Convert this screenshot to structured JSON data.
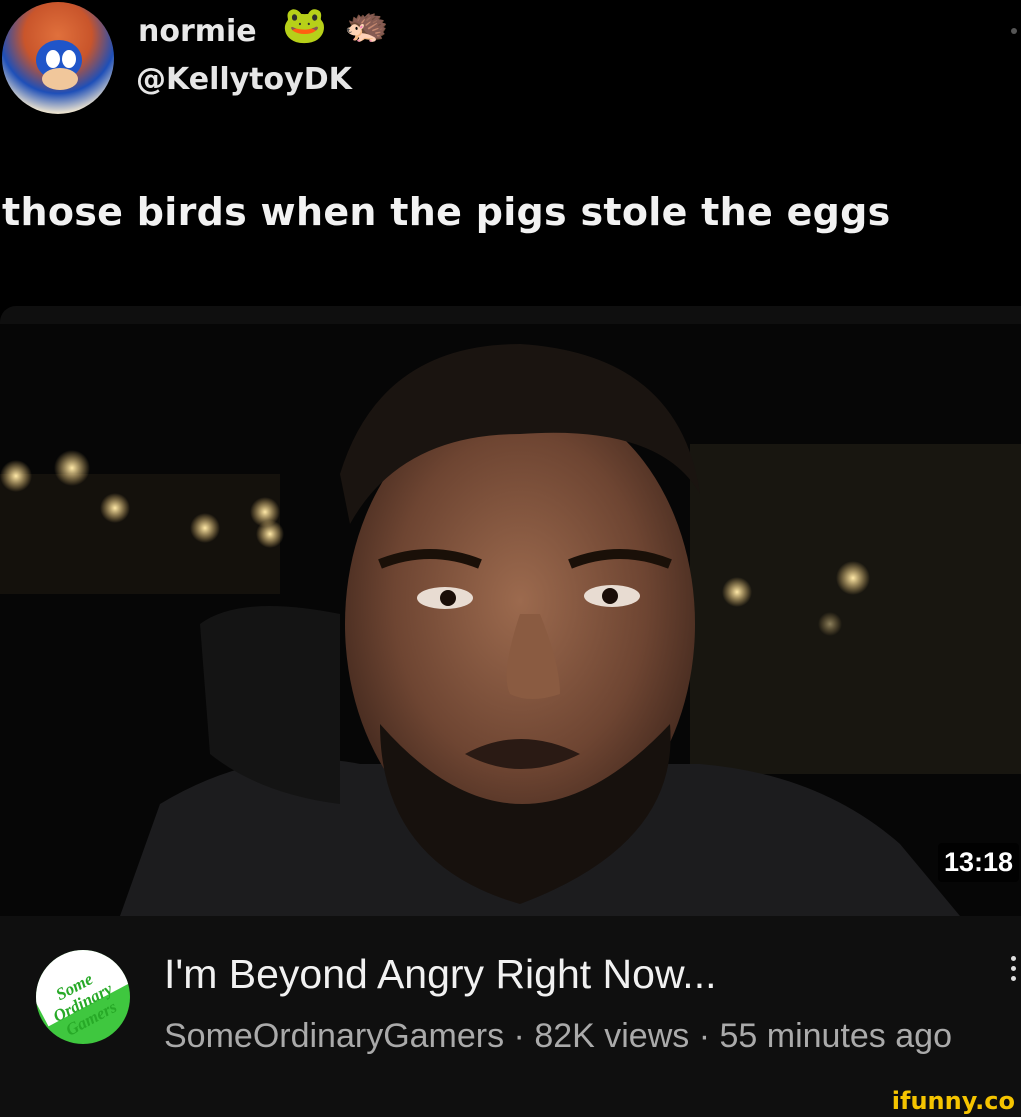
{
  "tweet": {
    "display_name": "normie",
    "name_emojis": [
      "🐸",
      "🦔"
    ],
    "handle": "@KellytoyDK",
    "text": "those birds when the pigs stole the eggs"
  },
  "video": {
    "duration": "13:18",
    "title": "I'm Beyond Angry Right Now...",
    "meta": "SomeOrdinaryGamers · 82K views · 55 minutes ago",
    "channel_avatar_text": "Some Ordinary Gamers"
  },
  "watermark": "ifunny.co",
  "colors": {
    "background": "#000000",
    "card_background": "#0f0f0f",
    "meta_text": "#aaaaaa",
    "watermark": "#f5c400",
    "channel_green": "#3fc73f"
  }
}
